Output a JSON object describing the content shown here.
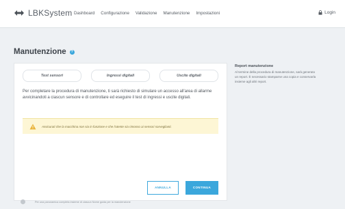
{
  "app": {
    "name": "LBKSystem"
  },
  "nav": {
    "items": [
      "Dashboard",
      "Configurazione",
      "Validazione",
      "Manutenzione",
      "Impostazioni"
    ],
    "login": "Login"
  },
  "page": {
    "title": "Manutenzione"
  },
  "tabs": [
    "Test sensori",
    "Ingressi digitali",
    "Uscite digitali"
  ],
  "main": {
    "description": "Per completare la procedura di manutenzione, ti sarà richiesto di simulare un accesso all'area di allarme avvicinandoti a ciascun sensore e di controllare ed eseguire il test di ingressi e uscite digitali.",
    "warning": "Assicurati che la macchina non sia in funzione e che l'utente sia rimosso ai sensori sorveglianti.",
    "cancel": "ANNULLA",
    "continue": "CONTINUA"
  },
  "side": {
    "title": "Report manutenzione",
    "text": "Al termine della procedura di manutenzione, sarà generato un report. È necessario stamparne una copia e conservarla insieme agli altri report."
  },
  "footer": {
    "text": "Per una panoramica completa insieme di ciascun Nome guida per la manutenzione"
  },
  "colors": {
    "accent": "#3ba7dc",
    "warning_bg": "#fdf6d5"
  }
}
